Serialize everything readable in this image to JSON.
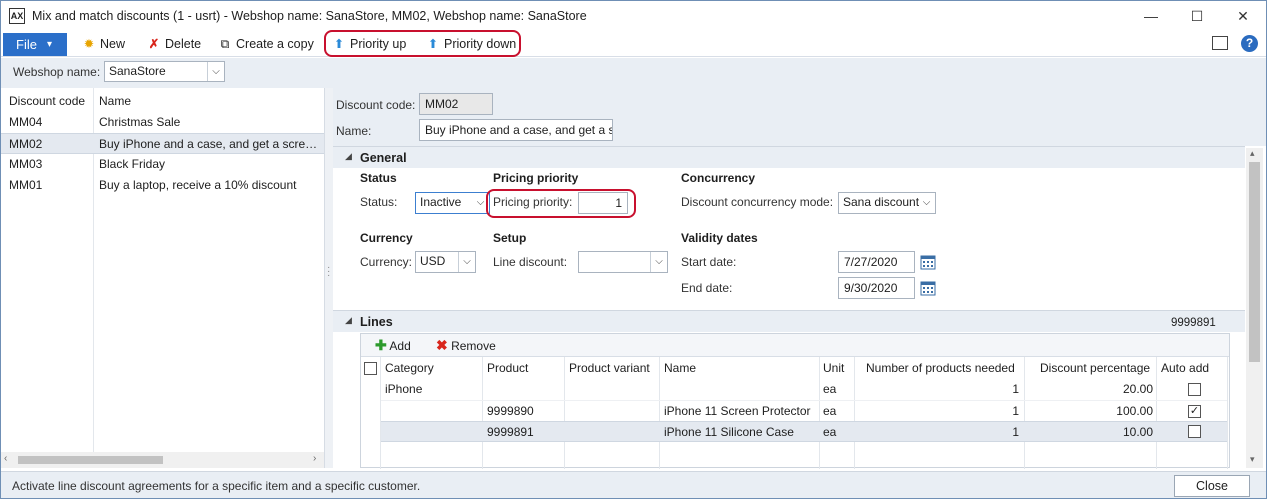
{
  "window": {
    "title": "Mix and match discounts (1 - usrt) - Webshop name: SanaStore, MM02, Webshop name: SanaStore",
    "app_icon": "AX",
    "minimize": "—",
    "maximize": "☐",
    "close": "✕"
  },
  "toolbar": {
    "file_label": "File",
    "file_arrow": "▾",
    "new_label": "New",
    "delete_label": "Delete",
    "copy_label": "Create a copy",
    "priority_up_label": "Priority up",
    "priority_down_label": "Priority down",
    "highlight_color": "#c8102e"
  },
  "filter": {
    "webshop_label": "Webshop name:",
    "webshop_value": "SanaStore"
  },
  "list": {
    "col_code": "Discount code",
    "col_name": "Name",
    "rows": [
      {
        "code": "MM04",
        "name": "Christmas Sale"
      },
      {
        "code": "MM02",
        "name": "Buy iPhone and a case, and get a screen ..."
      },
      {
        "code": "MM03",
        "name": "Black Friday"
      },
      {
        "code": "MM01",
        "name": "Buy a laptop, receive a 10% discount"
      }
    ],
    "selected_index": 1
  },
  "header": {
    "code_label": "Discount code:",
    "code_value": "MM02",
    "name_label": "Name:",
    "name_value": "Buy iPhone and a case, and get a s"
  },
  "general": {
    "title": "General",
    "status_group": "Status",
    "status_label": "Status:",
    "status_value": "Inactive",
    "pricing_group": "Pricing priority",
    "pricing_label": "Pricing priority:",
    "pricing_value": "1",
    "concurrency_group": "Concurrency",
    "concurrency_label": "Discount concurrency mode:",
    "concurrency_value": "Sana discount",
    "currency_group": "Currency",
    "currency_label": "Currency:",
    "currency_value": "USD",
    "setup_group": "Setup",
    "line_discount_label": "Line discount:",
    "line_discount_value": "",
    "validity_group": "Validity dates",
    "start_label": "Start date:",
    "start_value": "7/27/2020",
    "end_label": "End date:",
    "end_value": "9/30/2020"
  },
  "lines": {
    "title": "Lines",
    "current": "9999891",
    "add_label": "Add",
    "remove_label": "Remove",
    "columns": [
      "Category",
      "Product",
      "Product variant",
      "Name",
      "Unit",
      "Number of products needed",
      "Discount percentage",
      "Auto add"
    ],
    "rows": [
      {
        "category": "iPhone",
        "product": "",
        "variant": "",
        "name": "",
        "unit": "ea",
        "needed": "1",
        "percent": "20.00",
        "auto": false
      },
      {
        "category": "",
        "product": "9999890",
        "variant": "",
        "name": "iPhone 11 Screen Protector",
        "unit": "ea",
        "needed": "1",
        "percent": "100.00",
        "auto": true
      },
      {
        "category": "",
        "product": "9999891",
        "variant": "",
        "name": "iPhone 11 Silicone Case",
        "unit": "ea",
        "needed": "1",
        "percent": "10.00",
        "auto": false
      }
    ]
  },
  "status": {
    "message": "Activate line discount agreements for a specific item and a specific customer.",
    "close_label": "Close"
  }
}
